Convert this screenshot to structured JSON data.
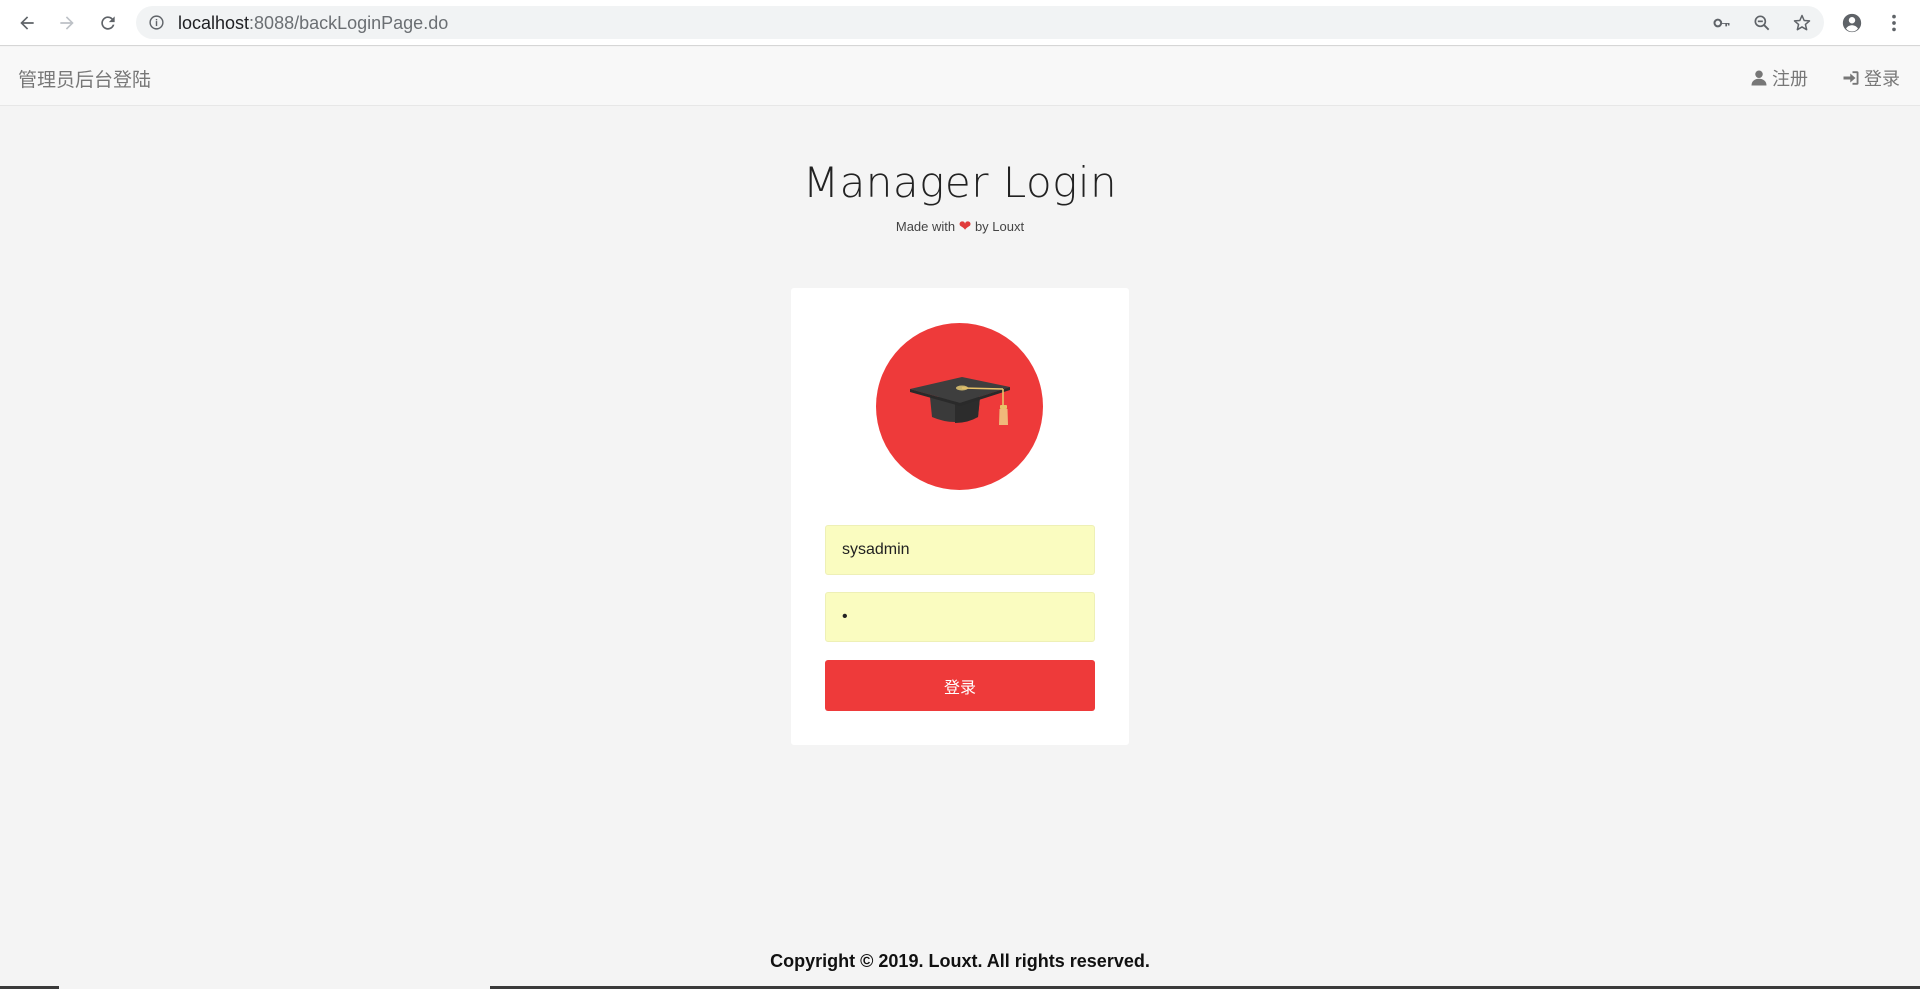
{
  "browser": {
    "url_host": "localhost",
    "url_rest": ":8088/backLoginPage.do",
    "icons": [
      "back-icon",
      "forward-icon",
      "reload-icon",
      "info-icon",
      "key-icon",
      "zoom-out-icon",
      "star-icon",
      "account-icon",
      "menu-icon"
    ]
  },
  "navbar": {
    "brand": "管理员后台登陆",
    "register_label": "注册",
    "login_label": "登录"
  },
  "page": {
    "title": "Manager Login",
    "subtitle_prefix": "Made with",
    "subtitle_suffix": "by Louxt"
  },
  "form": {
    "username_value": "sysadmin",
    "password_value": "1",
    "submit_label": "登录"
  },
  "footer": {
    "copyright": "Copyright © 2019. Louxt. All rights reserved."
  },
  "colors": {
    "accent": "#ee3a3a",
    "autofill": "#fafcc0",
    "navbar_bg": "#f8f8f8"
  }
}
